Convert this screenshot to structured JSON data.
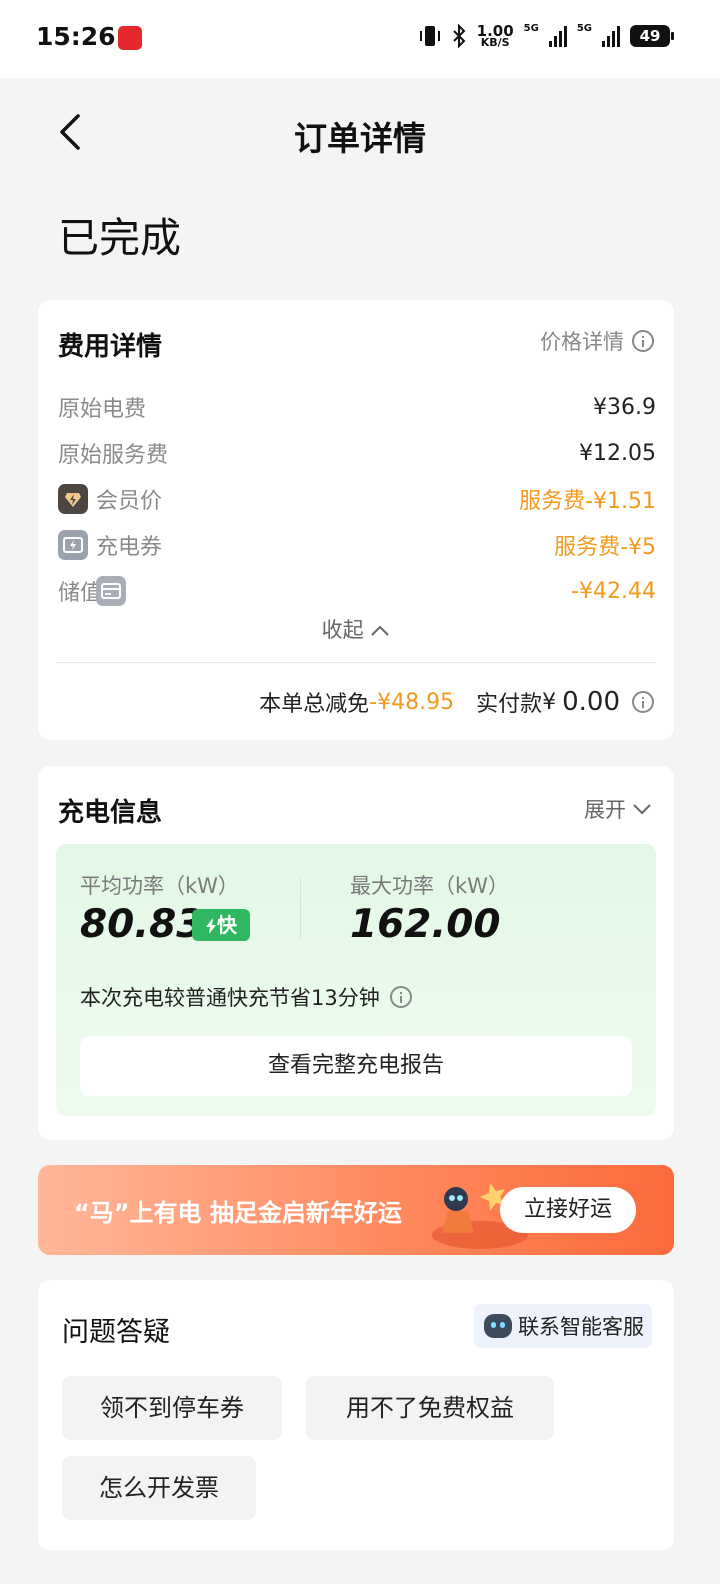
{
  "status_bar": {
    "time": "15:26",
    "speed_value": "1.00",
    "speed_unit": "KB/S",
    "network_1": "5G",
    "network_2": "5G",
    "battery": "49"
  },
  "header": {
    "title": "订单详情"
  },
  "order_status": "已完成",
  "fee_details": {
    "title": "费用详情",
    "price_detail_link": "价格详情",
    "rows": [
      {
        "label": "原始电费",
        "value": "¥36.9",
        "icon": ""
      },
      {
        "label": "原始服务费",
        "value": "¥12.05",
        "icon": ""
      },
      {
        "label": "会员价",
        "value": "服务费-¥1.51",
        "icon": "member-diamond-icon"
      },
      {
        "label": "充电券",
        "value": "服务费-¥5",
        "icon": "coupon-icon"
      },
      {
        "label": "储值卡",
        "value": "-¥42.44",
        "icon": "card-icon"
      }
    ],
    "collapse_label": "收起",
    "total_discount_label": "本单总减免",
    "total_discount_value": "-¥48.95",
    "paid_label": "实付款",
    "paid_currency": "¥",
    "paid_value": "0.00"
  },
  "charge_info": {
    "title": "充电信息",
    "expand_label": "展开",
    "avg_power_label": "平均功率（kW）",
    "avg_power_value": "80.83",
    "fast_badge": "快",
    "max_power_label": "最大功率（kW）",
    "max_power_value": "162.00",
    "save_text": "本次充电较普通快充节省13分钟",
    "report_button": "查看完整充电报告"
  },
  "promo_banner": {
    "text": "“马”上有电 抽足金启新年好运",
    "button": "立接好运",
    "colors": {
      "start": "#ffb79a",
      "end": "#fb6a3c"
    }
  },
  "faq": {
    "title": "问题答疑",
    "contact_button": "联系智能客服",
    "questions": [
      "领不到停车券",
      "用不了免费权益",
      "怎么开发票"
    ]
  },
  "colors": {
    "accent_orange": "#f39a1e",
    "fast_green": "#2fb860"
  }
}
